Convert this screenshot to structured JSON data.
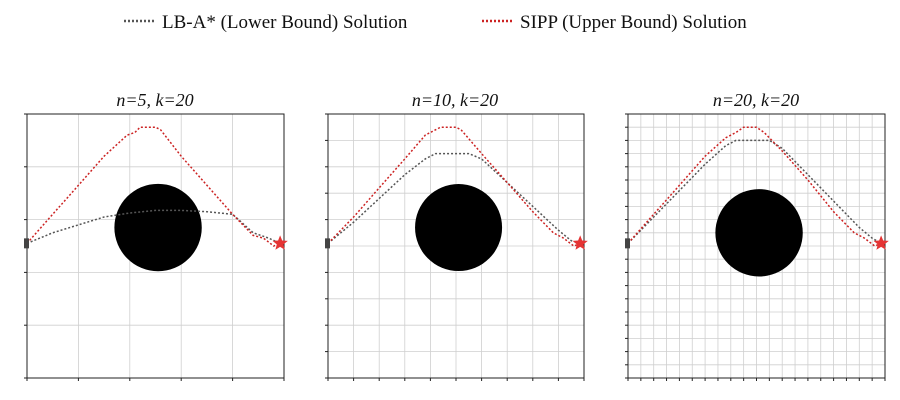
{
  "legend": {
    "items": [
      {
        "label": "LB-A* (Lower Bound) Solution",
        "color": "#555555",
        "key": "lb"
      },
      {
        "label": "SIPP (Upper Bound) Solution",
        "color": "#cc2222",
        "key": "ub"
      }
    ]
  },
  "colors": {
    "grid": "#cfcfcf",
    "obstacle": "#000000",
    "start_marker": "#444444",
    "goal_marker": "#e53333",
    "axes": "#222222"
  },
  "chart_data": [
    {
      "type": "line",
      "title": "n=5, k=20",
      "grid_divisions": 5,
      "xlim": [
        0,
        1
      ],
      "ylim": [
        0,
        1
      ],
      "obstacle": {
        "shape": "circle",
        "cx": 0.51,
        "cy": 0.57,
        "r": 0.17
      },
      "start": [
        0.0,
        0.51
      ],
      "goal": [
        0.985,
        0.51
      ],
      "series": [
        {
          "key": "lb",
          "x": [
            0.0,
            0.1,
            0.2,
            0.3,
            0.4,
            0.5,
            0.6,
            0.7,
            0.8,
            0.88,
            0.94,
            0.985
          ],
          "y": [
            0.51,
            0.55,
            0.58,
            0.61,
            0.625,
            0.635,
            0.635,
            0.63,
            0.62,
            0.55,
            0.53,
            0.51
          ]
        },
        {
          "key": "ub",
          "x": [
            0.0,
            0.1,
            0.2,
            0.3,
            0.39,
            0.42,
            0.44,
            0.5,
            0.52,
            0.6,
            0.7,
            0.8,
            0.88,
            0.92,
            0.96,
            0.985
          ],
          "y": [
            0.51,
            0.62,
            0.73,
            0.84,
            0.92,
            0.93,
            0.95,
            0.95,
            0.94,
            0.84,
            0.73,
            0.62,
            0.54,
            0.53,
            0.5,
            0.51
          ]
        }
      ]
    },
    {
      "type": "line",
      "title": "n=10, k=20",
      "grid_divisions": 10,
      "xlim": [
        0,
        1
      ],
      "ylim": [
        0,
        1
      ],
      "obstacle": {
        "shape": "circle",
        "cx": 0.51,
        "cy": 0.57,
        "r": 0.17
      },
      "start": [
        0.0,
        0.51
      ],
      "goal": [
        0.985,
        0.51
      ],
      "series": [
        {
          "key": "lb",
          "x": [
            0.0,
            0.1,
            0.2,
            0.3,
            0.38,
            0.42,
            0.55,
            0.6,
            0.7,
            0.8,
            0.9,
            0.95,
            0.985
          ],
          "y": [
            0.51,
            0.59,
            0.68,
            0.77,
            0.83,
            0.85,
            0.85,
            0.83,
            0.74,
            0.65,
            0.56,
            0.52,
            0.51
          ]
        },
        {
          "key": "ub",
          "x": [
            0.0,
            0.1,
            0.2,
            0.3,
            0.38,
            0.42,
            0.44,
            0.5,
            0.52,
            0.6,
            0.7,
            0.8,
            0.88,
            0.92,
            0.96,
            0.985
          ],
          "y": [
            0.51,
            0.61,
            0.72,
            0.83,
            0.92,
            0.94,
            0.95,
            0.95,
            0.94,
            0.85,
            0.74,
            0.63,
            0.55,
            0.53,
            0.5,
            0.51
          ]
        }
      ]
    },
    {
      "type": "line",
      "title": "n=20, k=20",
      "grid_divisions": 20,
      "xlim": [
        0,
        1
      ],
      "ylim": [
        0,
        1
      ],
      "obstacle": {
        "shape": "circle",
        "cx": 0.51,
        "cy": 0.55,
        "r": 0.17
      },
      "start": [
        0.0,
        0.51
      ],
      "goal": [
        0.985,
        0.51
      ],
      "series": [
        {
          "key": "lb",
          "x": [
            0.0,
            0.1,
            0.2,
            0.3,
            0.38,
            0.42,
            0.55,
            0.6,
            0.7,
            0.8,
            0.9,
            0.95,
            0.985
          ],
          "y": [
            0.51,
            0.61,
            0.71,
            0.81,
            0.88,
            0.9,
            0.9,
            0.87,
            0.77,
            0.67,
            0.57,
            0.53,
            0.51
          ]
        },
        {
          "key": "ub",
          "x": [
            0.0,
            0.1,
            0.2,
            0.3,
            0.38,
            0.42,
            0.45,
            0.5,
            0.53,
            0.6,
            0.7,
            0.8,
            0.88,
            0.92,
            0.96,
            0.985
          ],
          "y": [
            0.51,
            0.62,
            0.73,
            0.84,
            0.91,
            0.93,
            0.95,
            0.95,
            0.93,
            0.86,
            0.75,
            0.63,
            0.55,
            0.53,
            0.5,
            0.51
          ]
        }
      ]
    }
  ]
}
